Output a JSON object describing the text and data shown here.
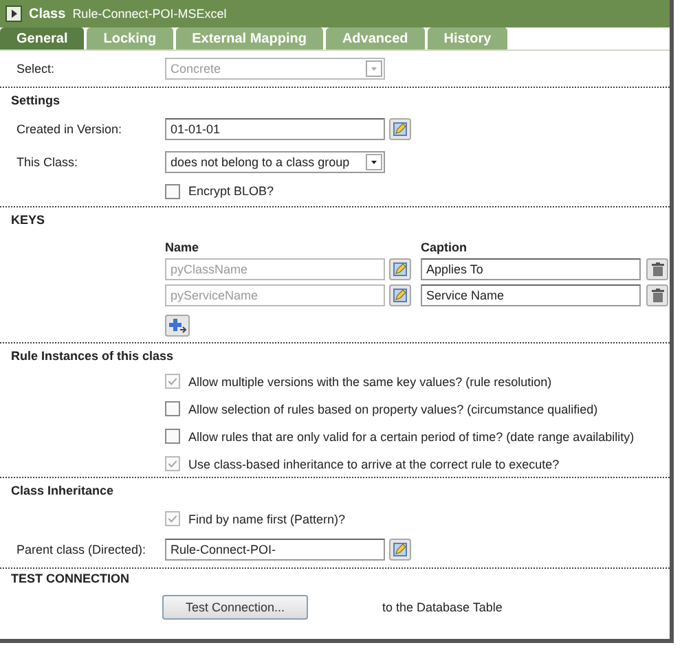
{
  "header": {
    "kind_label": "Class",
    "title": "Rule-Connect-POI-MSExcel"
  },
  "tabs": [
    {
      "label": "General",
      "selected": true
    },
    {
      "label": "Locking",
      "selected": false
    },
    {
      "label": "External Mapping",
      "selected": false
    },
    {
      "label": "Advanced",
      "selected": false
    },
    {
      "label": "History",
      "selected": false
    }
  ],
  "select": {
    "label": "Select:",
    "value": "Concrete",
    "disabled": true
  },
  "settings": {
    "heading": "Settings",
    "created_label": "Created in Version:",
    "created_value": "01-01-01",
    "class_label": "This Class:",
    "class_value": "does not belong to a class group",
    "encrypt": {
      "label": "Encrypt BLOB?",
      "checked": false,
      "disabled": false
    }
  },
  "keys": {
    "heading": "KEYS",
    "columns": [
      "Name",
      "Caption"
    ],
    "rows": [
      {
        "name": "pyClassName",
        "name_disabled": true,
        "caption": "Applies To"
      },
      {
        "name": "pyServiceName",
        "name_disabled": true,
        "caption": "Service Name"
      }
    ]
  },
  "rule_instances": {
    "heading": "Rule Instances of this class",
    "options": [
      {
        "label": "Allow multiple versions with the same key values? (rule resolution)",
        "checked": true,
        "disabled": true
      },
      {
        "label": "Allow selection of rules based on property values? (circumstance qualified)",
        "checked": false,
        "disabled": false
      },
      {
        "label": "Allow rules that are only valid for a certain period of time? (date range availability)",
        "checked": false,
        "disabled": false
      },
      {
        "label": "Use class-based inheritance to arrive at the correct rule to execute?",
        "checked": true,
        "disabled": true
      }
    ]
  },
  "inheritance": {
    "heading": "Class Inheritance",
    "find_by_name": {
      "label": "Find by name first (Pattern)?",
      "checked": true,
      "disabled": true
    },
    "parent_label": "Parent class (Directed):",
    "parent_value": "Rule-Connect-POI-"
  },
  "test_connection": {
    "heading": "TEST CONNECTION",
    "button": "Test Connection...",
    "note": "to the Database Table"
  }
}
